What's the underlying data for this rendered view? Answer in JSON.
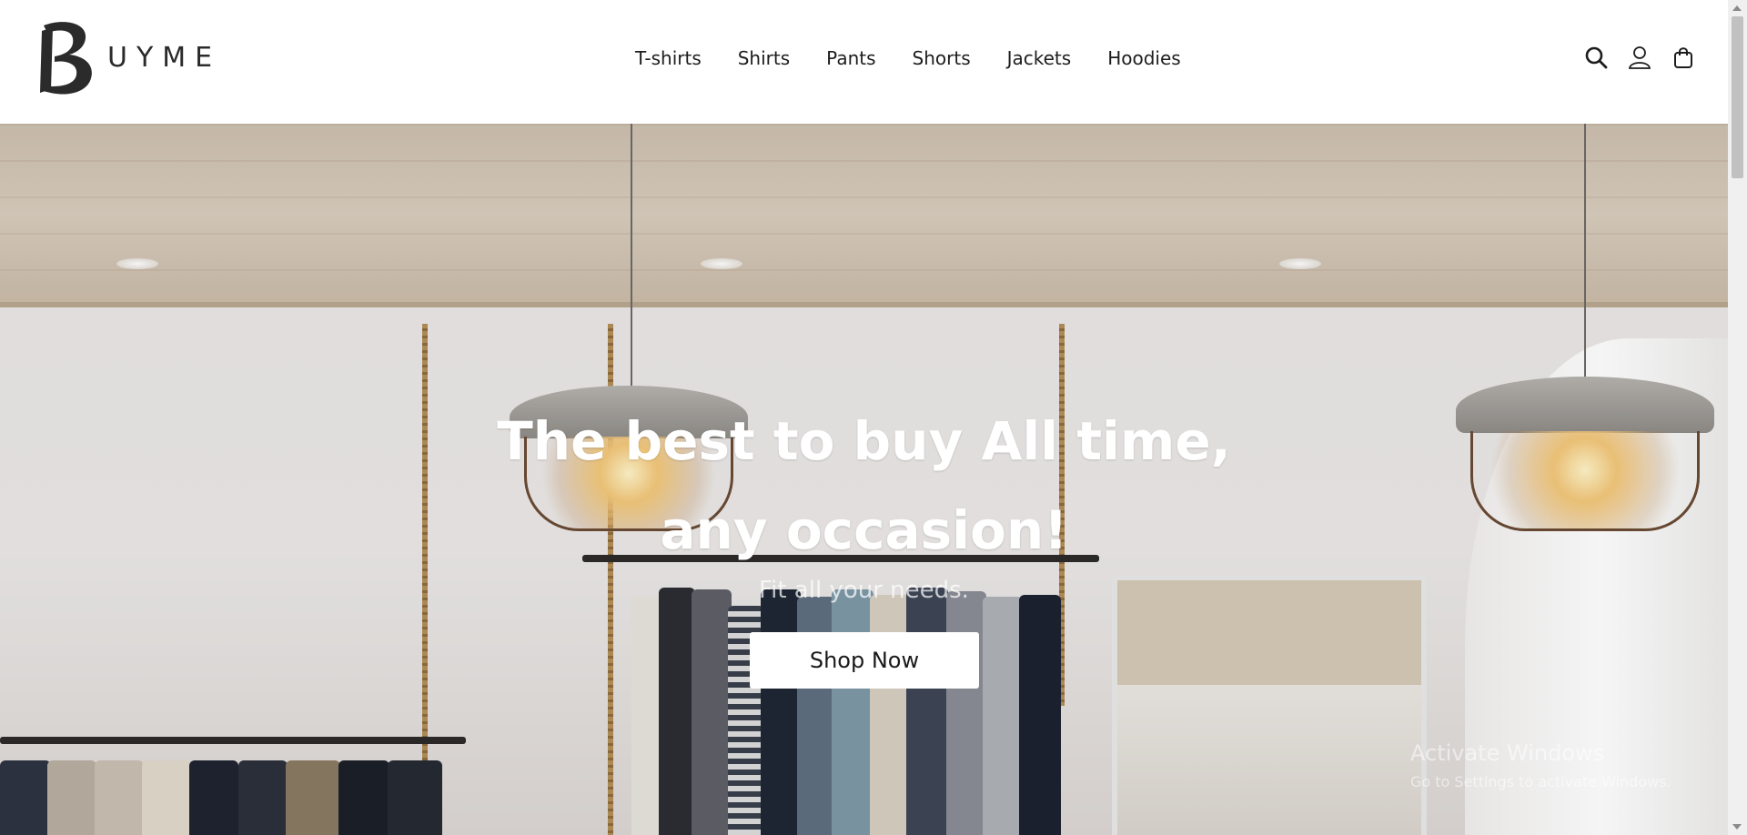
{
  "brand": {
    "name": "UYME",
    "logo_mark": "B"
  },
  "nav": {
    "items": [
      {
        "label": "T-shirts"
      },
      {
        "label": "Shirts"
      },
      {
        "label": "Pants"
      },
      {
        "label": "Shorts"
      },
      {
        "label": "Jackets"
      },
      {
        "label": "Hoodies"
      }
    ]
  },
  "header_icons": {
    "search": "search-icon",
    "account": "user-icon",
    "cart": "shopping-bag-icon"
  },
  "hero": {
    "title_line1": "The best to buy All time,",
    "title_line2": "any occasion!",
    "subtitle": "Fit all your needs.",
    "cta_label": "Shop Now"
  },
  "watermark": {
    "line1": "Activate Windows",
    "line2": "Go to Settings to activate Windows."
  },
  "colors": {
    "header_bg": "#ffffff",
    "text_dark": "#1d1d1d",
    "hero_text": "#ffffff",
    "button_bg": "#ffffff"
  }
}
